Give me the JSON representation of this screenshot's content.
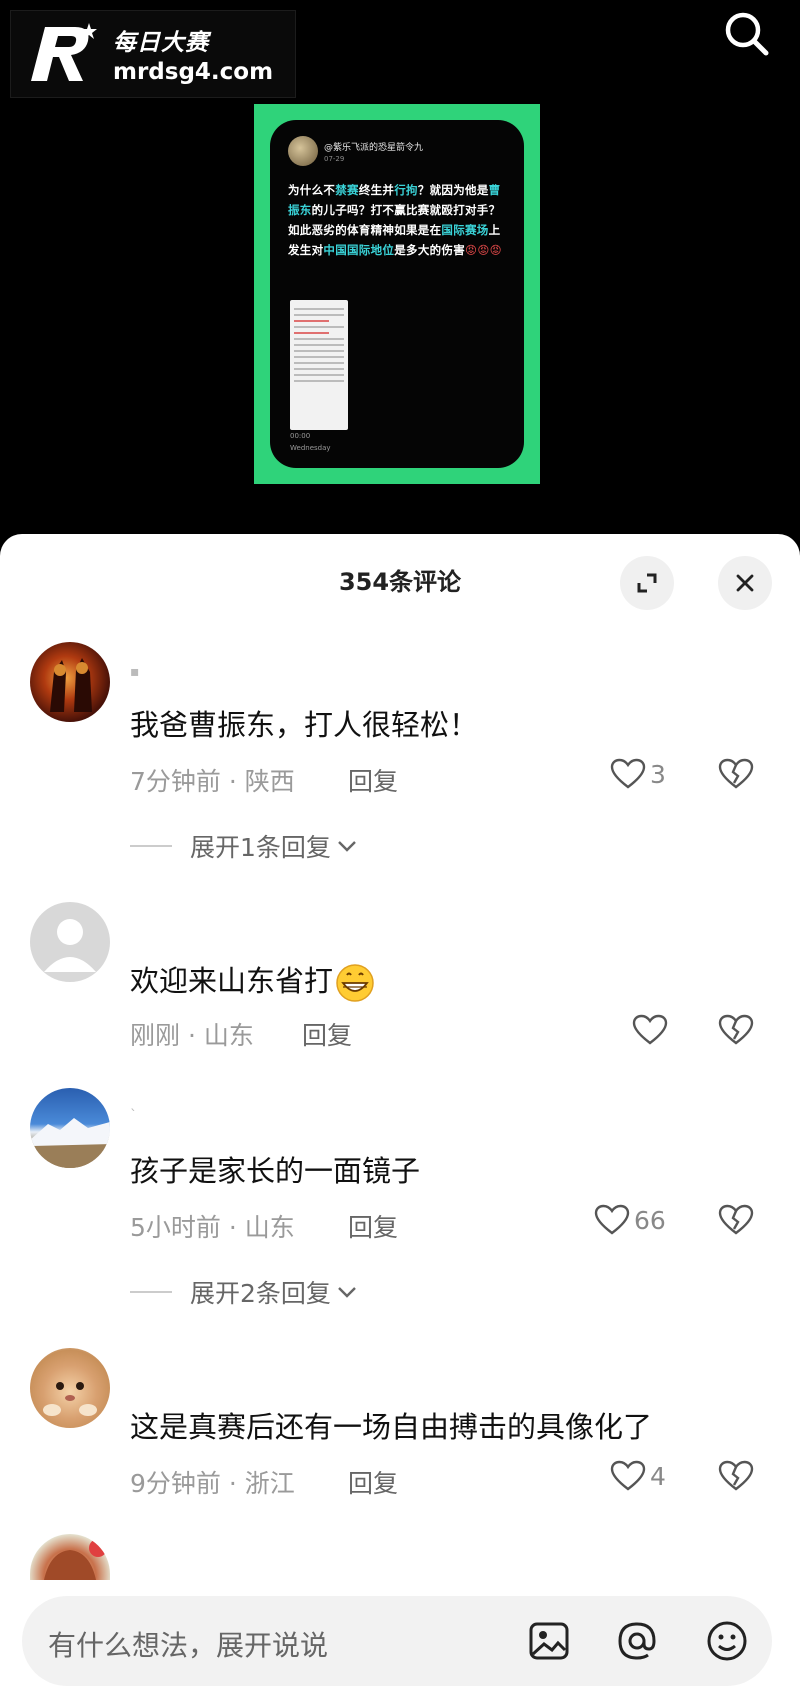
{
  "watermark": {
    "brand_cn": "每日大赛",
    "domain": "mrdsg4.com"
  },
  "post": {
    "username": "@紫乐飞派的恐星箭令九",
    "date": "07-29",
    "text_parts": [
      {
        "t": "为什么不",
        "c": ""
      },
      {
        "t": "禁赛",
        "c": "hl"
      },
      {
        "t": "终生并",
        "c": ""
      },
      {
        "t": "行拘",
        "c": "hl"
      },
      {
        "t": "？就因为他是",
        "c": ""
      },
      {
        "t": "曹振东",
        "c": "hl"
      },
      {
        "t": "的儿子吗？打不赢比赛就殴打对手？如此恶劣的体育精神如果是在",
        "c": ""
      },
      {
        "t": "国际赛场",
        "c": "hl"
      },
      {
        "t": "上发生对",
        "c": ""
      },
      {
        "t": "中国国际地位",
        "c": "hl"
      },
      {
        "t": "是多大的伤害",
        "c": ""
      },
      {
        "t": "😡😡😡",
        "c": "red"
      }
    ],
    "time": "00:00",
    "day": "Wednesday"
  },
  "sheet": {
    "title": "354条评论"
  },
  "comments": [
    {
      "name": "▪",
      "text": "我爸曹振东，打人很轻松！",
      "meta": "7分钟前 · 陕西",
      "reply": "回复",
      "likes": "3",
      "expand": "展开1条回复"
    },
    {
      "name": "",
      "text": "欢迎来山东省打",
      "meta": "刚刚 · 山东",
      "reply": "回复",
      "likes": "",
      "expand": ""
    },
    {
      "name": "ˋ",
      "text": "孩子是家长的一面镜子",
      "meta": "5小时前 · 山东",
      "reply": "回复",
      "likes": "66",
      "expand": "展开2条回复"
    },
    {
      "name": "",
      "text": "这是真赛后还有一场自由搏击的具像化了",
      "meta": "9分钟前 · 浙江",
      "reply": "回复",
      "likes": "4",
      "expand": ""
    }
  ],
  "input": {
    "placeholder": "有什么想法，展开说说"
  },
  "icons": {
    "search": "search-icon",
    "expand": "expand-icon",
    "close": "close-icon",
    "like": "heart-icon",
    "dislike": "broken-heart-icon",
    "image": "image-icon",
    "mention": "at-icon",
    "emoji": "emoji-icon"
  },
  "colors": {
    "frame_green": "#2fd37a",
    "highlight_cyan": "#3ad3d8"
  }
}
